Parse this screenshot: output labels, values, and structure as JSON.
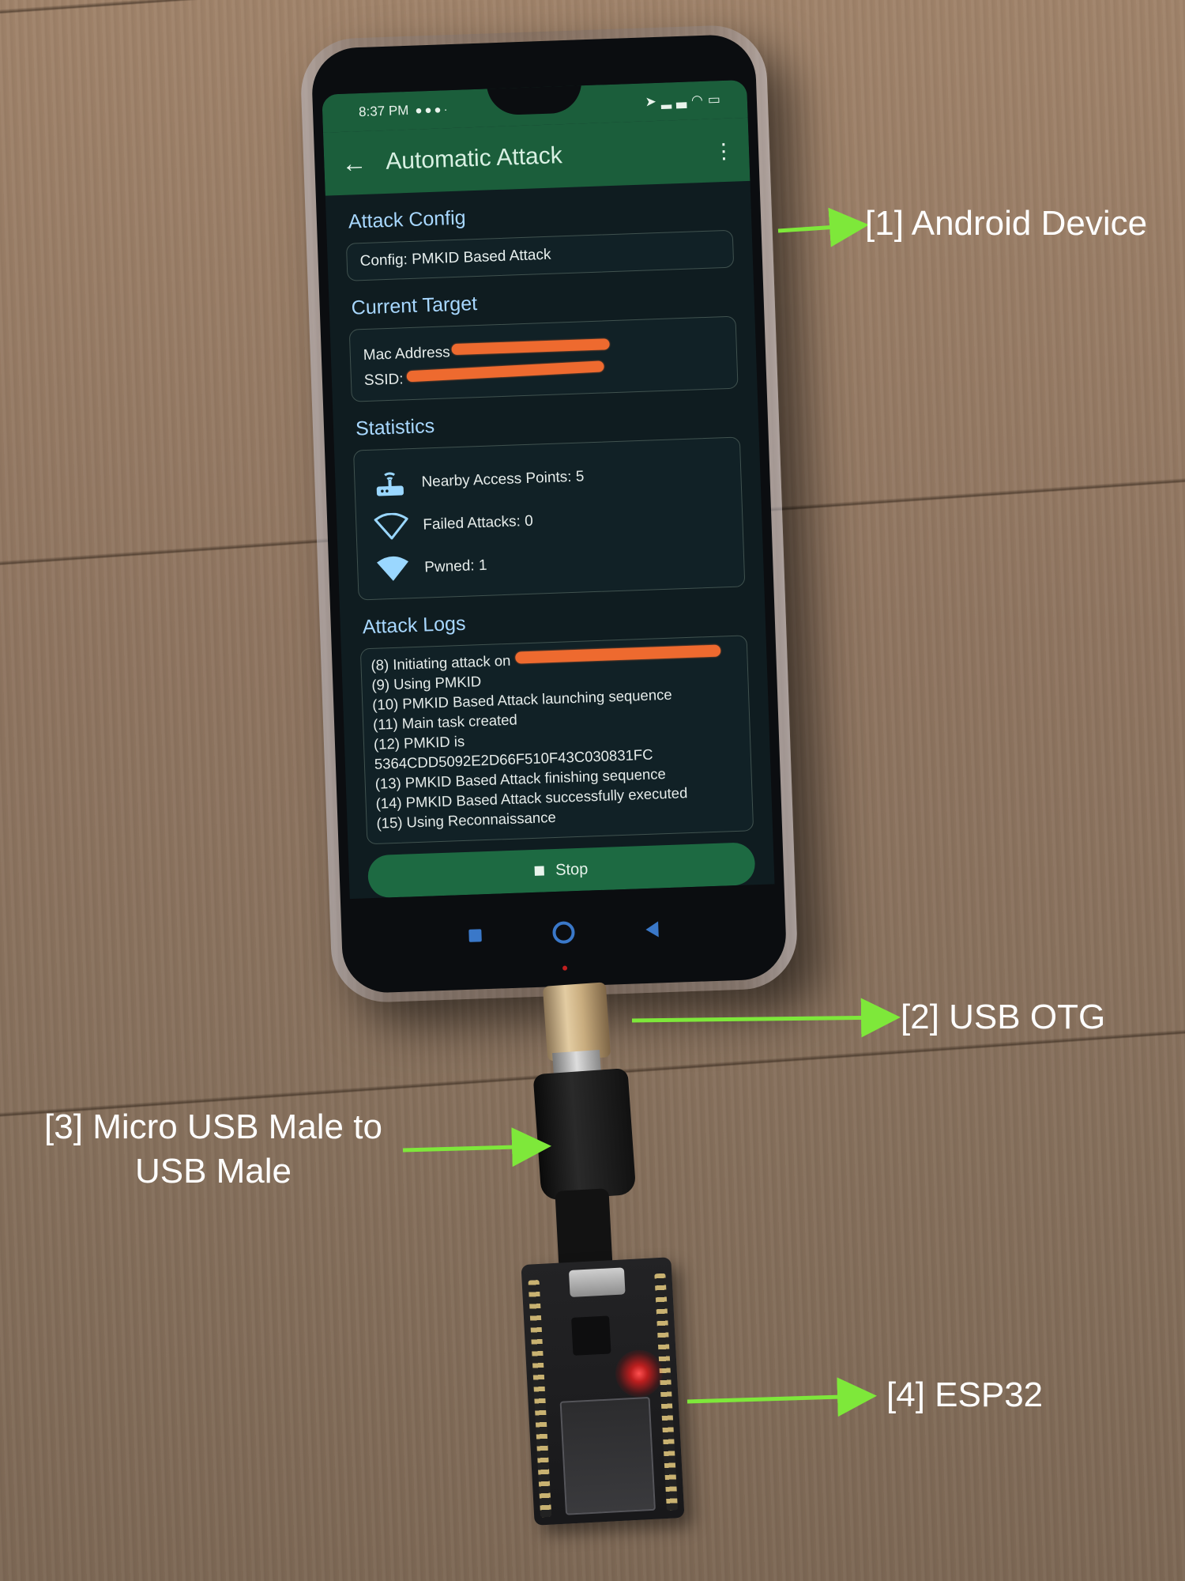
{
  "status_bar": {
    "time": "8:37 PM"
  },
  "app": {
    "title": "Automatic Attack",
    "sections": {
      "attack_config": "Attack Config",
      "current_target": "Current Target",
      "statistics": "Statistics",
      "attack_logs": "Attack Logs"
    },
    "config_text": "Config: PMKID Based Attack",
    "target": {
      "mac_label": "Mac Address",
      "ssid_label": "SSID:"
    },
    "stats": {
      "nearby": "Nearby Access Points: 5",
      "failed": "Failed Attacks: 0",
      "pwned": "Pwned: 1"
    },
    "logs": [
      "(8) Initiating attack on",
      "(9) Using PMKID",
      "(10) PMKID Based Attack launching sequence",
      "(11) Main task created",
      "(12) PMKID is",
      "5364CDD5092E2D66F510F43C030831FC",
      "(13) PMKID Based Attack finishing sequence",
      "(14) PMKID Based Attack successfully executed",
      "(15) Using Reconnaissance"
    ],
    "stop_label": "Stop"
  },
  "callouts": {
    "c1": "[1] Android Device",
    "c2": "[2] USB OTG",
    "c3_line1": "[3] Micro USB Male to",
    "c3_line2": "USB Male",
    "c4": "[4] ESP32"
  },
  "colors": {
    "arrow": "#7ee83a",
    "redaction": "#ee6a2f",
    "app_bar": "#1b5e3b"
  }
}
